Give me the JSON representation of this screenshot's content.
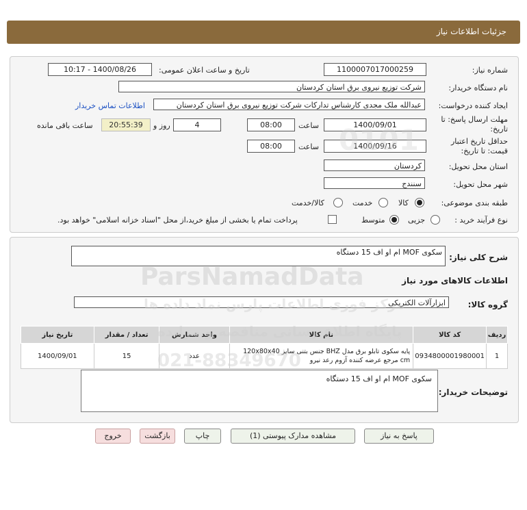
{
  "header": {
    "title": "جزئیات اطلاعات نیاز"
  },
  "form": {
    "need_number_label": "شماره نیاز:",
    "need_number": "1100007017000259",
    "announce_label": "تاریخ و ساعت اعلان عمومی:",
    "announce_value": "1400/08/26 - 10:17",
    "buyer_org_label": "نام دستگاه خریدار:",
    "buyer_org": "شرکت توزیع نیروی برق استان کردستان",
    "requester_label": "ایجاد کننده درخواست:",
    "requester": "عبدالله ملک مجدی کارشناس تدارکات شرکت توزیع نیروی برق استان کردستان",
    "contact_link": "اطلاعات تماس خریدار",
    "deadline_label_1": "مهلت ارسال پاسخ: تا",
    "deadline_label_2": "تاریخ:",
    "deadline_date": "1400/09/01",
    "time_label": "ساعت",
    "deadline_time": "08:00",
    "days_value": "4",
    "days_label": "روز و",
    "remaining_time": "20:55:39",
    "remaining_label": "ساعت باقی مانده",
    "validity_label_1": "حداقل تاریخ اعتبار",
    "validity_label_2": "قیمت: تا تاریخ:",
    "validity_date": "1400/09/16",
    "validity_time": "08:00",
    "province_label": "استان محل تحویل:",
    "province": "کردستان",
    "city_label": "شهر محل تحویل:",
    "city": "سنندج",
    "category_label": "طبقه بندی موضوعی:",
    "category_options": [
      "کالا",
      "خدمت",
      "کالا/خدمت"
    ],
    "process_label": "نوع فرآیند خرید :",
    "process_options": [
      "جزیی",
      "متوسط"
    ],
    "payment_note": "پرداخت تمام یا بخشی از مبلغ خرید،از محل \"اسناد خزانه اسلامی\" خواهد بود."
  },
  "summary": {
    "label": "شرح کلی نیاز:",
    "value": "سکوی MOF ام او اف 15 دستگاه",
    "goods_info_title": "اطلاعات کالاهای مورد نیاز",
    "group_label": "گروه کالا:",
    "group_value": "ابزارآلات الکتریکی"
  },
  "table": {
    "headers": [
      "ردیف",
      "کد کالا",
      "نام کالا",
      "واحد شمارش",
      "تعداد / مقدار",
      "تاریخ نیاز"
    ],
    "rows": [
      {
        "row": "1",
        "code": "0934800001980001",
        "name": "پایه سکوی تابلو برق مدل BHZ جنس بتنی سایز 120x80x40 cm مرجع عرضه کننده آزوم رعد نیرو",
        "unit": "عدد",
        "qty": "15",
        "date": "1400/09/01"
      }
    ]
  },
  "buyer_notes": {
    "label": "توضیحات خریدار:",
    "value": "سکوی MOF ام او اف 15 دستگاه"
  },
  "buttons": {
    "reply": "پاسخ به نیاز",
    "attachments": "مشاهده مدارک پیوستی (1)",
    "print": "چاپ",
    "back": "بازگشت",
    "exit": "خروج"
  },
  "watermark": {
    "brand": "ParsNamadData",
    "line1": "مرکز فوری اطلاعات پارس نماد داده ها",
    "line2": "پایگاه اطلاع رسانی مناقصه و مزایده",
    "phone": "021-88349670",
    "code": "0101"
  },
  "colors": {
    "header": "#8a6a3c",
    "link": "#1a4fc2",
    "timer_bg": "#f3f0c8"
  }
}
